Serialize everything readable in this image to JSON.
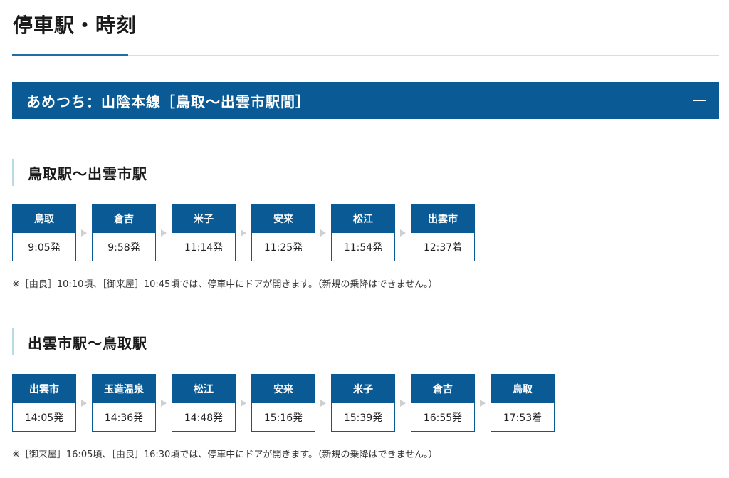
{
  "page": {
    "title": "停車駅・時刻"
  },
  "accordion": {
    "title": "あめつち：山陰本線［鳥取〜出雲市駅間］",
    "toggle_icon": "minus-icon"
  },
  "sections": [
    {
      "heading": "鳥取駅〜出雲市駅",
      "stops": [
        {
          "name": "鳥取",
          "time": "9:05発"
        },
        {
          "name": "倉吉",
          "time": "9:58発"
        },
        {
          "name": "米子",
          "time": "11:14発"
        },
        {
          "name": "安来",
          "time": "11:25発"
        },
        {
          "name": "松江",
          "time": "11:54発"
        },
        {
          "name": "出雲市",
          "time": "12:37着"
        }
      ],
      "note": "※［由良］10:10頃、［御来屋］10:45頃では、停車中にドアが開きます。（新規の乗降はできません。）"
    },
    {
      "heading": "出雲市駅〜鳥取駅",
      "stops": [
        {
          "name": "出雲市",
          "time": "14:05発"
        },
        {
          "name": "玉造温泉",
          "time": "14:36発"
        },
        {
          "name": "松江",
          "time": "14:48発"
        },
        {
          "name": "安来",
          "time": "15:16発"
        },
        {
          "name": "米子",
          "time": "15:39発"
        },
        {
          "name": "倉吉",
          "time": "16:55発"
        },
        {
          "name": "鳥取",
          "time": "17:53着"
        }
      ],
      "note": "※［御来屋］16:05頃、［由良］16:30頃では、停車中にドアが開きます。（新規の乗降はできません。）"
    }
  ],
  "colors": {
    "accent": "#0a5b95",
    "rule": "#c9e3ee",
    "arrow": "#cfcfcf"
  }
}
